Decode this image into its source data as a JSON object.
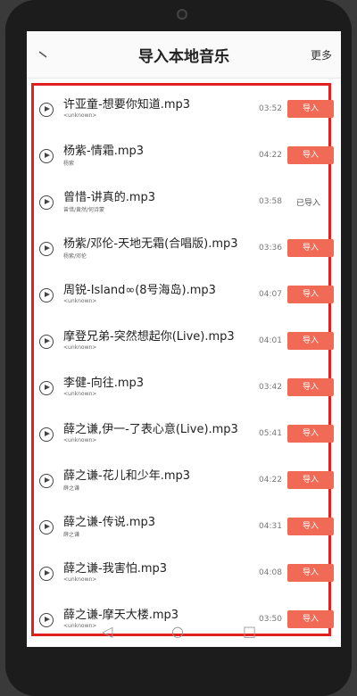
{
  "header": {
    "title": "导入本地音乐",
    "more_label": "更多",
    "back_icon": "chevron-left-icon"
  },
  "songs": [
    {
      "title": "许亚童-想要你知道.mp3",
      "artist": "<unknown>",
      "duration": "03:52",
      "action": "导入",
      "imported": false
    },
    {
      "title": "杨紫-情霜.mp3",
      "artist": "杨紫",
      "duration": "04:22",
      "action": "导入",
      "imported": false
    },
    {
      "title": "曾惜-讲真的.mp3",
      "artist": "曾惜/黄然/何诗蒙",
      "duration": "03:58",
      "action": "已导入",
      "imported": true
    },
    {
      "title": "杨紫/邓伦-天地无霜(合唱版).mp3",
      "artist": "杨紫/邓伦",
      "duration": "03:36",
      "action": "导入",
      "imported": false
    },
    {
      "title": "周锐-Island∞(8号海岛).mp3",
      "artist": "<unknown>",
      "duration": "04:07",
      "action": "导入",
      "imported": false
    },
    {
      "title": "摩登兄弟-突然想起你(Live).mp3",
      "artist": "<unknown>",
      "duration": "04:01",
      "action": "导入",
      "imported": false
    },
    {
      "title": "李健-向往.mp3",
      "artist": "<unknown>",
      "duration": "03:42",
      "action": "导入",
      "imported": false
    },
    {
      "title": "薛之谦,伊一-了表心意(Live).mp3",
      "artist": "<unknown>",
      "duration": "05:41",
      "action": "导入",
      "imported": false
    },
    {
      "title": "薛之谦-花儿和少年.mp3",
      "artist": "薛之谦",
      "duration": "04:22",
      "action": "导入",
      "imported": false
    },
    {
      "title": "薛之谦-传说.mp3",
      "artist": "薛之谦",
      "duration": "04:31",
      "action": "导入",
      "imported": false
    },
    {
      "title": "薛之谦-我害怕.mp3",
      "artist": "<unknown>",
      "duration": "04:08",
      "action": "导入",
      "imported": false
    },
    {
      "title": "薛之谦-摩天大楼.mp3",
      "artist": "<unknown>",
      "duration": "03:50",
      "action": "导入",
      "imported": false
    }
  ],
  "colors": {
    "accent": "#f06a55",
    "highlight_border": "#e02020"
  },
  "navbar": {
    "back": "◁",
    "home": "○",
    "recents": "□"
  }
}
